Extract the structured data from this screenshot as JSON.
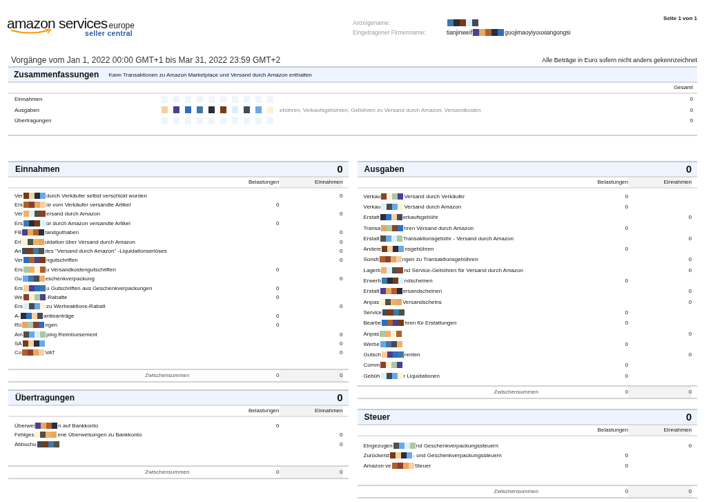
{
  "header": {
    "logo": {
      "brand": "amazon services",
      "region": "europe",
      "product": "seller central"
    },
    "fields": [
      {
        "label": "Anzeigename:"
      },
      {
        "label": "Eingetragener Firmenname:",
        "value_head": "tianjinweif",
        "value_tail": "guojimaoyiyouxiangongsi"
      }
    ],
    "page": "Seite 1 von 1"
  },
  "period": "Vorgänge vom Jan 1, 2022 00:00 GMT+1 bis Mar 31, 2022 23:59 GMT+2",
  "currency_note": "Alle Beträge in Euro sofern nicht anders gekennzeichnet",
  "summary": {
    "title": "Zusammenfassungen",
    "note": "Kann Transaktionen zu Amazon Marketplace und Versand durch Amazon enthalten",
    "column": "Gesamt",
    "rows": [
      {
        "label": "Einnahmen",
        "total": "0"
      },
      {
        "label": "Ausgaben",
        "description": "ebühren, Verkaufsgebühren, Gebühren zu Versand durch Amazon, Versandkosten",
        "total": "0"
      },
      {
        "label": "Übertragungen",
        "total": "0"
      }
    ]
  },
  "left": [
    {
      "title": "Einnahmen",
      "total": "0",
      "columns": [
        "Belastungen",
        "Einnahmen"
      ],
      "rows": [
        {
          "head": "Ver",
          "tail": "durch Verkäufer selbst verschickt wurden",
          "credit": "0"
        },
        {
          "head": "Ers",
          "tail": "ür vom Verkäufer versandte Artikel",
          "debit": "0"
        },
        {
          "head": "Ver",
          "tail": "ersand durch Amazon",
          "credit": "0"
        },
        {
          "head": "Ers",
          "tail": "ür durch Amazon versandte Artikel",
          "debit": "0"
        },
        {
          "head": "FB",
          "tail": "tandguthaben",
          "credit": "0"
        },
        {
          "head": "Erl",
          "tail": "uidation über Versand durch Amazon",
          "credit": "0"
        },
        {
          "head": "An",
          "tail": "des \"Versand durch Amazon\" -Liquidationserlöses",
          "credit": "0"
        },
        {
          "head": "Ver",
          "tail": "ngutschriften",
          "credit": "0"
        },
        {
          "head": "Ers",
          "tail": "u Versandkostengutschriften",
          "debit": "0"
        },
        {
          "head": "Gu",
          "tail": "eschenkverpackung",
          "credit": "0"
        },
        {
          "head": "Ers",
          "tail": "u Gutschriften aus Geschenkverpackungen",
          "debit": "0"
        },
        {
          "head": "We",
          "tail": "-Rabatte",
          "debit": "0"
        },
        {
          "head": "Ers",
          "tail": "zu Werbeaktions-Rabatt",
          "credit": "0"
        },
        {
          "head": "A-",
          "tail": "antieanträge",
          "debit": "0"
        },
        {
          "head": "Rü",
          "tail": "ngen",
          "debit": "0"
        },
        {
          "head": "Am",
          "tail": "ping Reimbursement",
          "credit": "0"
        },
        {
          "head": "SA",
          "credit": "0"
        },
        {
          "head": "Co",
          "tail": "VAT",
          "credit": "0"
        }
      ],
      "subtotal": {
        "label": "Zwischensummen",
        "debit": "0",
        "credit": "0"
      }
    },
    {
      "title": "Übertragungen",
      "total": "0",
      "columns": [
        "Belastungen",
        "Einnahmen"
      ],
      "rows": [
        {
          "head": "Überwei",
          "tail": "n auf Bankkonto",
          "debit": "0"
        },
        {
          "head": "Fehlges",
          "tail": "ene Überweisungen zu Bankkonto",
          "credit": "0"
        },
        {
          "head": "Abbuchu",
          "credit": "0"
        }
      ],
      "subtotal": {
        "label": "Zwischensummen",
        "debit": "0",
        "credit": "0"
      }
    }
  ],
  "right": [
    {
      "title": "Ausgaben",
      "total": "0",
      "columns": [
        "Belastungen",
        "Einnahmen"
      ],
      "rows": [
        {
          "head": "Verkau",
          "tail": "Versand durch Verkäufer",
          "debit": "0"
        },
        {
          "head": "Verkau",
          "tail": "Versand durch Amazon",
          "debit": "0"
        },
        {
          "head": "Erstatt",
          "tail": "erkaufsgebühr",
          "credit": "0"
        },
        {
          "head": "Transa",
          "tail": "hren Versand durch Amazon",
          "debit": "0"
        },
        {
          "head": "Erstatt",
          "tail": "Transaktionsgebühr - Versand durch Amazon",
          "credit": "0"
        },
        {
          "head": "Andere",
          "tail": "nsgebühren",
          "debit": "0"
        },
        {
          "head": "Sonsti",
          "tail": "ngen zu Transaktionsgebühren",
          "credit": "0"
        },
        {
          "head": "Lagerb",
          "tail": "nd Service-Gebühren für Versand durch Amazon",
          "credit": "0"
        },
        {
          "head": "Erwerb",
          "tail": "ndscheinen",
          "debit": "0"
        },
        {
          "head": "Erstatt",
          "tail": "ersandscheinen",
          "credit": "0"
        },
        {
          "head": "Anpas",
          "tail": "Versandscheins",
          "credit": "0"
        },
        {
          "head": "Service",
          "debit": "0"
        },
        {
          "head": "Bearbe",
          "tail": "hren für Erstattungen",
          "debit": "0"
        },
        {
          "head": "Anpas",
          "credit": "0"
        },
        {
          "head": "Werbe",
          "debit": "0"
        },
        {
          "head": "Gutsch",
          "tail": "renten",
          "credit": "0"
        },
        {
          "head": "Comm",
          "debit": "0"
        },
        {
          "head": "Gebüh",
          "tail": "r Liquidationen",
          "debit": "0"
        }
      ],
      "subtotal": {
        "label": "Zwischensummen",
        "debit": "0",
        "credit": "0"
      }
    },
    {
      "title": "Steuer",
      "total": "0",
      "columns": [
        "Belastungen",
        "Einnahmen"
      ],
      "rows": [
        {
          "head": "Eingezogen",
          "tail": "nd Geschenkverpackungssteuern",
          "credit": "0"
        },
        {
          "head": "Zurückerst",
          "tail": "- und Geschenkverpackungssteuern",
          "debit": "0"
        },
        {
          "head": "Amazon ve",
          "tail": "Steuer",
          "debit": "0"
        }
      ],
      "subtotal": {
        "label": "Zwischensummen",
        "debit": "0",
        "credit": "0"
      }
    }
  ]
}
